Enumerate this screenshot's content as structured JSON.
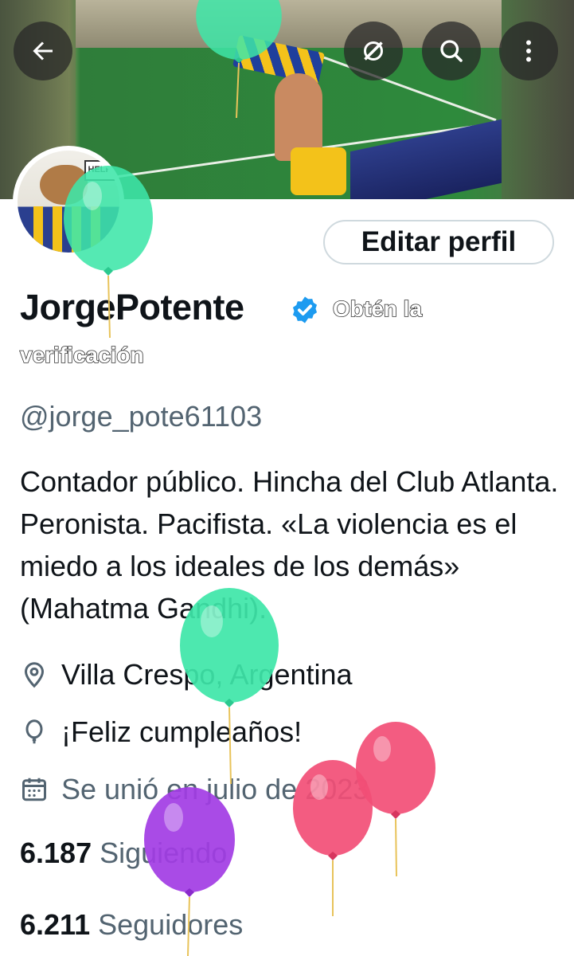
{
  "profile": {
    "display_name": "JorgePotente",
    "get_verified_line1": "Obtén la",
    "get_verified_line2": "verificación",
    "handle": "@jorge_pote61103",
    "bio": "Contador público. Hincha del Club Atlanta. Peronista. Pacifista. «La violencia es el miedo a los ideales de los demás» (Mahatma Gandhi).",
    "location": "Villa Crespo, Argentina",
    "birthday": "¡Feliz cumpleaños!",
    "joined": "Se unió en julio de 2023",
    "following_count": "6.187",
    "following_label": "Siguiendo",
    "followers_count": "6.211",
    "followers_label": "Seguidores",
    "avatar_sign": "HELP!"
  },
  "actions": {
    "edit_profile": "Editar perfil"
  },
  "icons": {
    "back": "arrow-left-icon",
    "grok": "grok-icon",
    "search": "search-icon",
    "more": "more-vertical-icon",
    "verified": "verified-badge-icon",
    "location": "location-pin-icon",
    "birthday": "balloon-icon",
    "calendar": "calendar-icon"
  },
  "colors": {
    "verified_blue": "#1d9bf0",
    "balloon_green": "#3ee6a8",
    "balloon_pink": "#f24e76",
    "balloon_purple": "#a23ce4"
  }
}
